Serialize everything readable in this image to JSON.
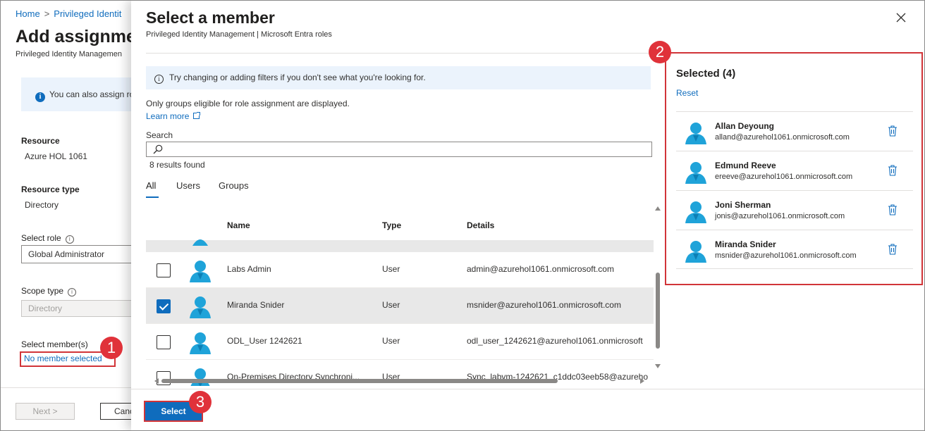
{
  "background": {
    "breadcrumb": [
      "Home",
      "Privileged Identit"
    ],
    "title": "Add assignmen",
    "subtitle": "Privileged Identity Managemen",
    "info": "You can also assign ro",
    "fields": {
      "resource_label": "Resource",
      "resource_value": "Azure HOL 1061",
      "resource_type_label": "Resource type",
      "resource_type_value": "Directory",
      "role_label": "Select role",
      "role_value": "Global Administrator",
      "scope_label": "Scope type",
      "scope_value": "Directory",
      "member_label": "Select member(s)",
      "member_link": "No member selected"
    },
    "footer": {
      "next": "Next >",
      "cancel": "Canc"
    }
  },
  "panel": {
    "title": "Select a member",
    "subtitle": "Privileged Identity Management | Microsoft Entra roles",
    "tip": "Try changing or adding filters if you don't see what you're looking for.",
    "eligible_note": "Only groups eligible for role assignment are displayed.",
    "learn_more": "Learn more",
    "search_label": "Search",
    "search_value": "",
    "results_count": "8 results found",
    "tabs": [
      "All",
      "Users",
      "Groups"
    ],
    "active_tab": "All",
    "columns": [
      "Name",
      "Type",
      "Details"
    ],
    "rows": [
      {
        "name": "Labs Admin",
        "type": "User",
        "details": "admin@azurehol1061.onmicrosoft.com",
        "checked": false
      },
      {
        "name": "Miranda Snider",
        "type": "User",
        "details": "msnider@azurehol1061.onmicrosoft.com",
        "checked": true
      },
      {
        "name": "ODL_User 1242621",
        "type": "User",
        "details": "odl_user_1242621@azurehol1061.onmicrosoft",
        "checked": false
      },
      {
        "name": "On-Premises Directory Synchroni...",
        "type": "User",
        "details": "Sync_labvm-1242621_c1ddc03eeb58@azureho",
        "checked": false
      }
    ],
    "select_button": "Select"
  },
  "selected": {
    "title": "Selected (4)",
    "reset": "Reset",
    "items": [
      {
        "name": "Allan Deyoung",
        "email": "alland@azurehol1061.onmicrosoft.com"
      },
      {
        "name": "Edmund Reeve",
        "email": "ereeve@azurehol1061.onmicrosoft.com"
      },
      {
        "name": "Joni Sherman",
        "email": "jonis@azurehol1061.onmicrosoft.com"
      },
      {
        "name": "Miranda Snider",
        "email": "msnider@azurehol1061.onmicrosoft.com"
      }
    ]
  },
  "callouts": [
    "1",
    "2",
    "3"
  ],
  "colors": {
    "accent": "#0f6cbd",
    "callout": "#e0323a",
    "highlight_border": "#d13438",
    "avatar": "#1fa3d9"
  }
}
